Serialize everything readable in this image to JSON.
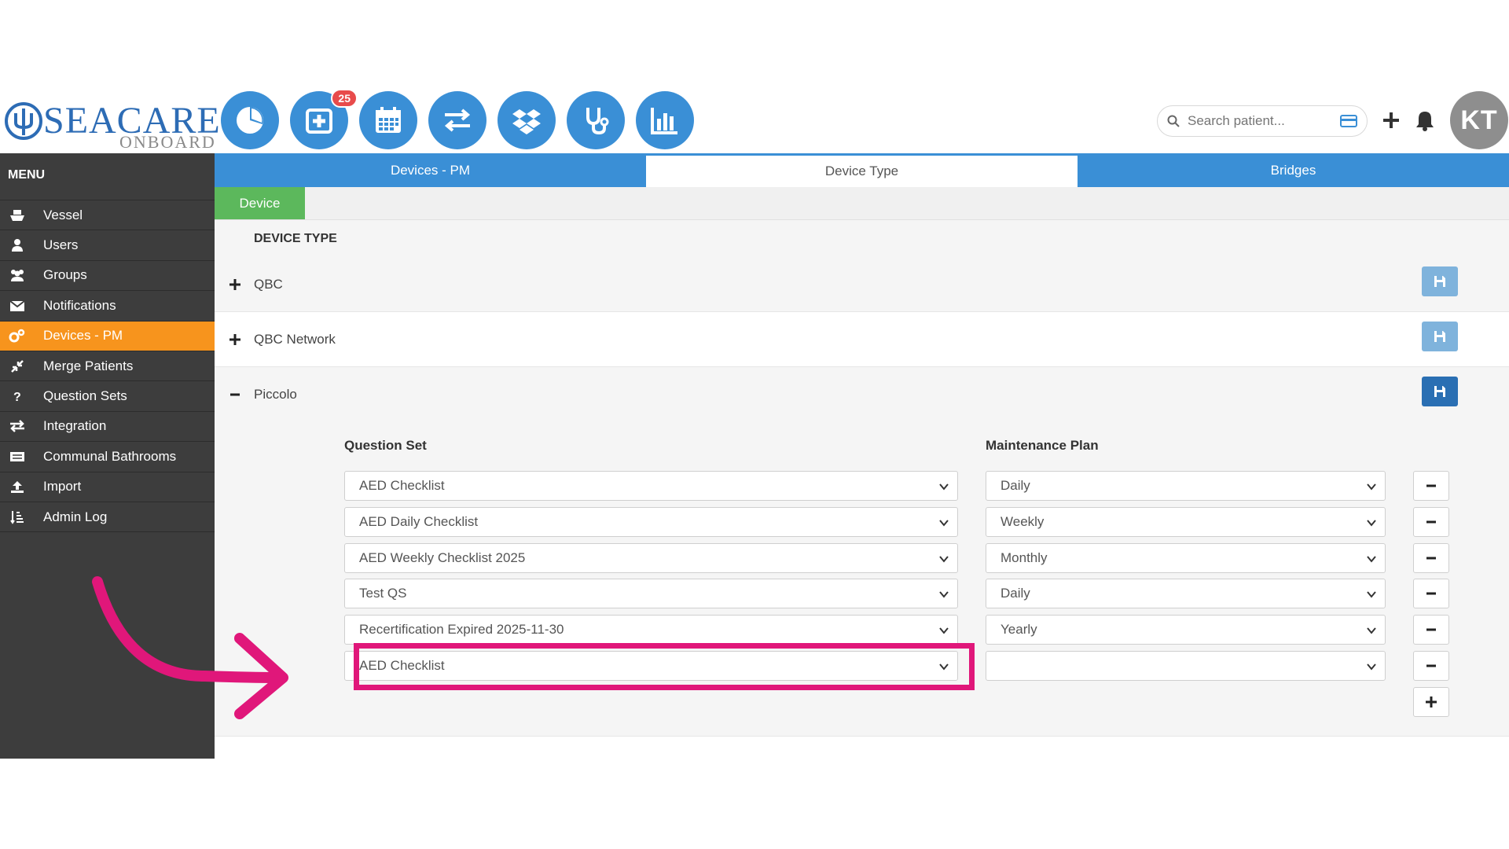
{
  "header": {
    "logo_text": "SEACARE",
    "logo_sub": "ONBOARD",
    "nav_icons": [
      "dashboard-pie-icon",
      "medical-plus-icon",
      "calendar-icon",
      "transfer-arrows-icon",
      "dropbox-icon",
      "stethoscope-icon",
      "bar-chart-icon"
    ],
    "badge_count": "25",
    "search_placeholder": "Search patient...",
    "avatar_initials": "KT"
  },
  "sidebar": {
    "title": "MENU",
    "items": [
      {
        "label": "Vessel",
        "icon": "ship-icon"
      },
      {
        "label": "Users",
        "icon": "user-icon"
      },
      {
        "label": "Groups",
        "icon": "group-icon"
      },
      {
        "label": "Notifications",
        "icon": "envelope-icon"
      },
      {
        "label": "Devices - PM",
        "icon": "gears-icon",
        "active": true
      },
      {
        "label": "Merge Patients",
        "icon": "compress-icon"
      },
      {
        "label": "Question Sets",
        "icon": "question-icon"
      },
      {
        "label": "Integration",
        "icon": "exchange-icon"
      },
      {
        "label": "Communal Bathrooms",
        "icon": "list-card-icon"
      },
      {
        "label": "Import",
        "icon": "upload-icon"
      },
      {
        "label": "Admin Log",
        "icon": "sort-list-icon"
      }
    ]
  },
  "tabs": [
    {
      "label": "Devices - PM"
    },
    {
      "label": "Device Type",
      "active": true
    },
    {
      "label": "Bridges"
    }
  ],
  "subtab": "Device",
  "device_type_header": "DEVICE TYPE",
  "device_types": [
    {
      "name": "QBC",
      "expanded": false
    },
    {
      "name": "QBC Network",
      "expanded": false
    },
    {
      "name": "Piccolo",
      "expanded": true
    }
  ],
  "piccolo": {
    "question_set_label": "Question Set",
    "maintenance_plan_label": "Maintenance Plan",
    "rows": [
      {
        "question_set": "AED Checklist",
        "plan": "Daily"
      },
      {
        "question_set": "AED Daily Checklist",
        "plan": "Weekly"
      },
      {
        "question_set": "AED Weekly Checklist 2025",
        "plan": "Monthly"
      },
      {
        "question_set": "Test QS",
        "plan": "Daily"
      },
      {
        "question_set": "Recertification Expired 2025-11-30",
        "plan": "Yearly"
      },
      {
        "question_set": "AED Checklist",
        "plan": ""
      }
    ]
  },
  "colors": {
    "primary_blue": "#3a8fd6",
    "active_orange": "#f7941d",
    "green": "#5cb85c",
    "highlight_pink": "#e0177a",
    "sidebar_bg": "#3d3d3d"
  }
}
